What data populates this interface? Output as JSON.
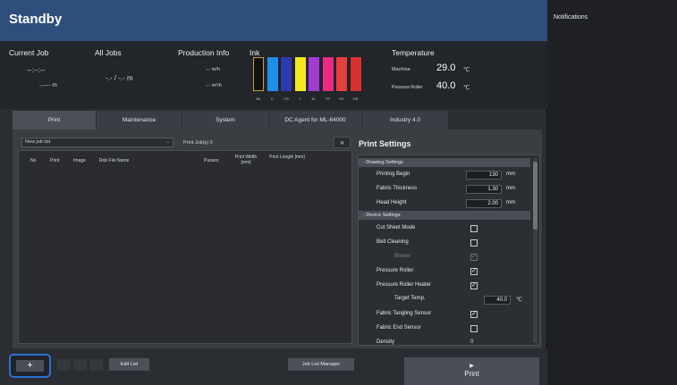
{
  "title": "Standby",
  "notifications": {
    "title": "Notifications"
  },
  "status": {
    "current_job": {
      "label": "Current Job",
      "time": "--:--:--",
      "length": "-.---- m"
    },
    "all_jobs": {
      "label": "All Jobs",
      "value": "-.- / -.- m"
    },
    "production_info": {
      "label": "Production Info",
      "rate1": "-.- m/h",
      "rate2": "-.- m²/h"
    },
    "ink": {
      "label": "Ink",
      "channels": [
        {
          "name": "BK",
          "color": "#111111",
          "empty": true
        },
        {
          "name": "C",
          "color": "#1e8fe6"
        },
        {
          "name": "CR",
          "color": "#2e3bb0"
        },
        {
          "name": "Y",
          "color": "#f3e81e"
        },
        {
          "name": "BL",
          "color": "#a23bd2"
        },
        {
          "name": "FP",
          "color": "#ea2b86"
        },
        {
          "name": "RD",
          "color": "#e3403a"
        },
        {
          "name": "OR",
          "color": "#d8302c"
        }
      ]
    },
    "temperature": {
      "label": "Temperature",
      "machine_label": "Machine",
      "machine_value": "29.0",
      "roller_label": "Pressure Roller",
      "roller_value": "40.0",
      "unit": "℃"
    }
  },
  "tabs": [
    "Print",
    "Maintenance",
    "System",
    "DC Agent for ML-64000",
    "Industry 4.0"
  ],
  "job_list": {
    "select_value": "New job list",
    "count_label": "Print Job(s)  0",
    "expand_icon": "»",
    "columns": [
      "No",
      "Print",
      "Image",
      "Rob File Name",
      "Passes",
      "Print Width [mm]",
      "Print Length [mm]"
    ]
  },
  "print_settings": {
    "title": "Print Settings",
    "sections": {
      "drawing": "- Drawing Settings",
      "device": "- Device Settings"
    },
    "printing_begin": {
      "label": "Printing Begin",
      "value": "130",
      "unit": "mm"
    },
    "fabric_thickness": {
      "label": "Fabric Thickness",
      "value": "1.30",
      "unit": "mm"
    },
    "head_height": {
      "label": "Head Height",
      "value": "2.00",
      "unit": "mm"
    },
    "cut_sheet_mode": {
      "label": "Cut Sheet Mode",
      "checked": false
    },
    "belt_cleaning": {
      "label": "Belt Cleaning",
      "checked": false
    },
    "blower": {
      "label": "Blower",
      "checked": true,
      "disabled": true
    },
    "pressure_roller": {
      "label": "Pressure Roller",
      "checked": true
    },
    "pressure_roller_heater": {
      "label": "Pressure Roller Heater",
      "checked": true
    },
    "target_temp": {
      "label": "Target Temp.",
      "value": "40.0",
      "unit": "℃"
    },
    "fabric_tangling_sensor": {
      "label": "Fabric Tangling Sensor",
      "checked": true
    },
    "fabric_end_sensor": {
      "label": "Fabric End Sensor",
      "checked": false
    },
    "density": {
      "label": "Density",
      "value": "0"
    }
  },
  "bottom": {
    "add_label": "+",
    "edit_list_label": "Edit List",
    "job_list_manager_label": "Job List Manager",
    "print_icon": "▶",
    "print_label": "Print"
  }
}
